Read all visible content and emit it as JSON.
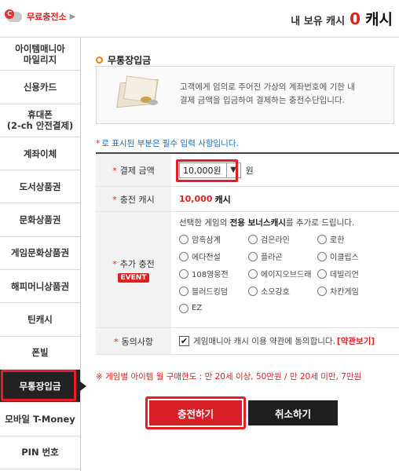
{
  "header": {
    "charge_link": "무료충전소",
    "pig_coin": "C",
    "cash_label": "내 보유 캐시",
    "cash_value": "0",
    "cash_unit": "캐시"
  },
  "sidebar": {
    "items": [
      {
        "label": "아이템매니아\n마일리지"
      },
      {
        "label": "신용카드"
      },
      {
        "label": "휴대폰\n(2-ch 안전결제)"
      },
      {
        "label": "계좌이체"
      },
      {
        "label": "도서상품권"
      },
      {
        "label": "문화상품권"
      },
      {
        "label": "게임문화상품권"
      },
      {
        "label": "해피머니상품권"
      },
      {
        "label": "틴캐시"
      },
      {
        "label": "폰빌"
      },
      {
        "label": "무통장입금",
        "active": true
      },
      {
        "label": "모바일 T-Money"
      },
      {
        "label": "PIN 번호"
      }
    ]
  },
  "main": {
    "title": "무통장입금",
    "info_line1": "고객에게 임의로 주어진 가상의 계좌번호에 기한 내",
    "info_line2": "결제 금액을 입금하여 결제하는 충전수단입니다.",
    "required_note": "로 표시된 부분은 필수 입력 사항입니다.",
    "form": {
      "amount_label": "결제 금액",
      "amount_value": "10,000원",
      "amount_unit": "원",
      "charge_cash_label": "충전 캐시",
      "charge_cash_value": "10,000",
      "charge_cash_unit": "캐시",
      "bonus_label": "추가 충전",
      "event_badge": "EVENT",
      "bonus_pre": "선택한 게임의 ",
      "bonus_bold": "전용 보너스캐시",
      "bonus_post": "를 추가로 드립니다.",
      "games": [
        "암흑삼계",
        "검은라인",
        "로한",
        "에다전설",
        "플라곤",
        "이클립스",
        "108영웅전",
        "에이지오브드래",
        "데빌리언",
        "블러드킹덤",
        "소오강호",
        "차칸게임",
        "EZ"
      ],
      "agree_label": "동의사항",
      "agree_text": "게임매니아 캐시 이용 약관에 동의합니다.",
      "terms_link": "[약관보기]"
    },
    "limit_note": "※ 게임별 아이템 월 구매한도 : 만 20세 이상, 50만원 / 만 20세 미만, 7만원",
    "charge_button": "충전하기",
    "cancel_button": "취소하기"
  }
}
